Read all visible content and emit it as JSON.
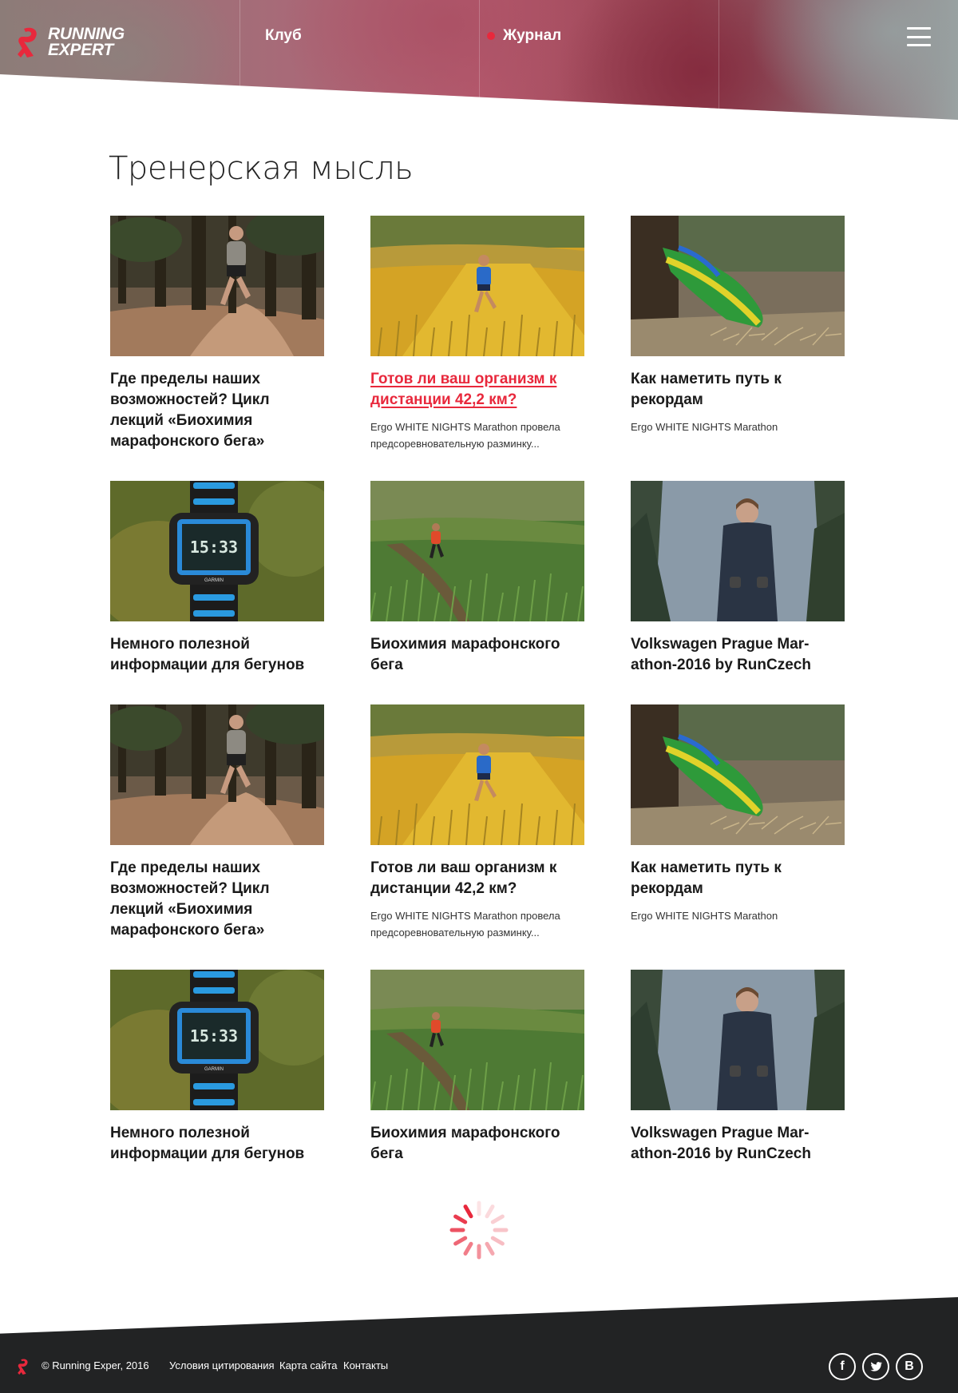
{
  "header": {
    "logo_line1": "RUNNING",
    "logo_line2": "EXPERT",
    "nav": [
      {
        "label": "Клуб"
      },
      {
        "label": "Журнал"
      }
    ]
  },
  "main": {
    "title": "Тренерская мысль",
    "cards": [
      {
        "title": "Где пределы наших возможностей? Цикл лекций «Биохимия марафонского бега»",
        "desc": "",
        "image": "man-running-forest-trail"
      },
      {
        "title": "Готов ли ваш организм к дистанции 42,2 км?",
        "desc": "Ergo WHITE NIGHTS Marathon провела предсоревновательную разминку...",
        "image": "woman-running-yellow-field",
        "active": true
      },
      {
        "title": "Как наметить путь к рекордам",
        "desc": "Ergo WHITE NIGHTS Marathon",
        "image": "green-trail-shoe"
      },
      {
        "title": "Немного полезной информации для бегунов",
        "desc": "",
        "image": "garmin-watch-moss"
      },
      {
        "title": "Биохимия марафонского бега",
        "desc": "",
        "image": "runner-green-meadow"
      },
      {
        "title": "Volkswagen Prague Mar-athon-2016 by RunCzech",
        "desc": "",
        "image": "woman-dark-jacket-forest"
      },
      {
        "title": "Где пределы наших возможностей? Цикл лекций «Биохимия марафонского бега»",
        "desc": "",
        "image": "man-running-forest-trail"
      },
      {
        "title": "Готов ли ваш организм к дистанции 42,2 км?",
        "desc": "Ergo WHITE NIGHTS Marathon провела предсоревновательную разминку...",
        "image": "woman-running-yellow-field"
      },
      {
        "title": "Как наметить путь к рекордам",
        "desc": "Ergo WHITE NIGHTS Marathon",
        "image": "green-trail-shoe"
      },
      {
        "title": "Немного полезной информации для бегунов",
        "desc": "",
        "image": "garmin-watch-moss"
      },
      {
        "title": "Биохимия марафонского бега",
        "desc": "",
        "image": "runner-green-meadow"
      },
      {
        "title": "Volkswagen Prague Mar-athon-2016 by RunCzech",
        "desc": "",
        "image": "woman-dark-jacket-forest"
      }
    ],
    "watch_time": "15:33",
    "watch_brand": "GARMIN"
  },
  "footer": {
    "copyright": "© Running Exper, 2016",
    "links": [
      "Условия цитирования",
      "Карта сайта",
      "Контакты"
    ],
    "social": [
      {
        "icon": "facebook-icon",
        "glyph": "f"
      },
      {
        "icon": "twitter-icon",
        "glyph": "t"
      },
      {
        "icon": "vk-icon",
        "glyph": "B"
      }
    ]
  },
  "colors": {
    "accent": "#e8283c",
    "footer_bg": "#222324"
  }
}
